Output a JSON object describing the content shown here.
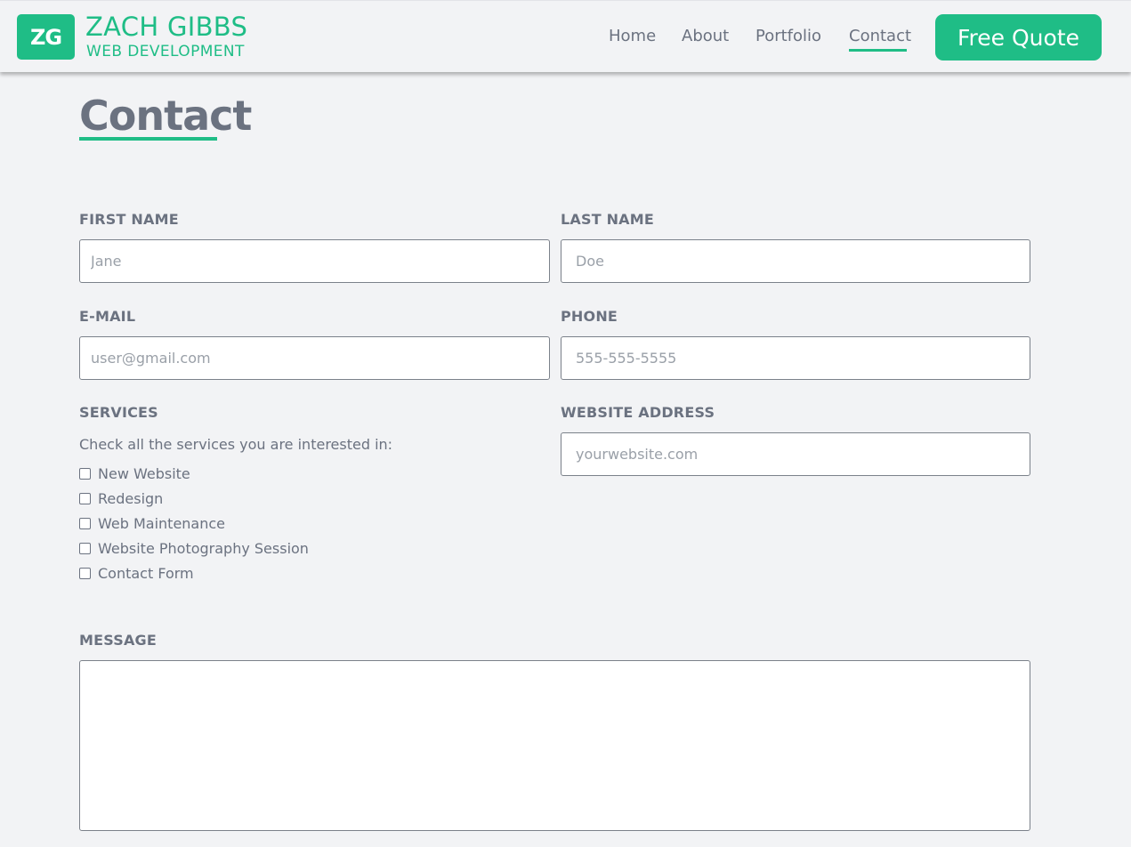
{
  "header": {
    "logo_text": "ZG",
    "brand_name": "ZACH GIBBS",
    "brand_tagline": "WEB DEVELOPMENT",
    "nav": [
      {
        "label": "Home"
      },
      {
        "label": "About"
      },
      {
        "label": "Portfolio"
      },
      {
        "label": "Contact",
        "active": true
      }
    ],
    "cta_label": "Free Quote"
  },
  "page": {
    "title": "Contact"
  },
  "form": {
    "first_name": {
      "label": "FIRST NAME",
      "placeholder": "Jane",
      "value": ""
    },
    "last_name": {
      "label": "LAST NAME",
      "placeholder": "Doe",
      "value": ""
    },
    "email": {
      "label": "E-MAIL",
      "placeholder": "user@gmail.com",
      "value": ""
    },
    "phone": {
      "label": "PHONE",
      "placeholder": "555-555-5555",
      "value": ""
    },
    "services": {
      "label": "SERVICES",
      "hint": "Check all the services you are interested in:",
      "options": [
        {
          "label": "New Website",
          "checked": false
        },
        {
          "label": "Redesign",
          "checked": false
        },
        {
          "label": "Web Maintenance",
          "checked": false
        },
        {
          "label": "Website Photography Session",
          "checked": false
        },
        {
          "label": "Contact Form",
          "checked": false
        }
      ]
    },
    "website": {
      "label": "WEBSITE ADDRESS",
      "placeholder": "yourwebsite.com",
      "value": ""
    },
    "message": {
      "label": "MESSAGE",
      "value": ""
    }
  },
  "colors": {
    "accent": "#1fbd86",
    "text": "#6b7280",
    "background": "#f2f3f5"
  }
}
